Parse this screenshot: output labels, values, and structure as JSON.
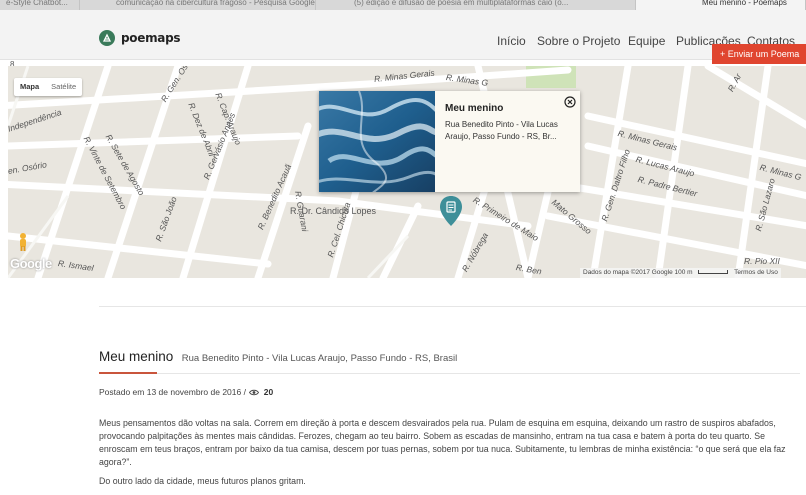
{
  "browser": {
    "tabs": [
      {
        "label": "e-Style Chatbot..."
      },
      {
        "label": "comunicação na cibercultura fragoso - Pesquisa Google"
      },
      {
        "label": "(5) edição e difusão de poesia em multiplataformas caio (o..."
      },
      {
        "label": "Meu menino - Poemaps"
      }
    ]
  },
  "header": {
    "logo_text": "poemaps",
    "nav": [
      "Início",
      "Sobre o Projeto",
      "Equipe",
      "Publicações",
      "Contatos"
    ],
    "send_button": "+ Enviar um Poema",
    "mark": "8"
  },
  "map": {
    "type_control": {
      "map": "Mapa",
      "satellite": "Satélite"
    },
    "streets": [
      "R. Minas Gerais",
      "R. Minas G",
      "R. Gen. Osório",
      "R. Cap. Araujo",
      "R. Dez de Abril",
      "Independência",
      "R. Sete de Agosto",
      "R. Vinte de Setembro",
      "R. Gervásio Annes",
      "en. Osório",
      "R. Benedito Acauã",
      "R. Guarani",
      "R. Dr. Cândido Lopes",
      "R. São João",
      "R. Ismael",
      "R. Cel. Chicuta",
      "R. Primeiro de Maio",
      "Mato Grosso",
      "R. Gen. Daltro Filho",
      "R. Minas Gerais",
      "R. Lucas Araujo",
      "R. Padre Bertier",
      "R. São Lazaro",
      "R. Minas G",
      "R. Pio XII",
      "R. Ben",
      "R. Nóbrega",
      "R. Ar"
    ],
    "google_label": "Google",
    "attribution": "Dados do mapa ©2017 Google   100 m",
    "terms": "Termos de Uso",
    "marker_icon": "map-pin-icon",
    "infowindow": {
      "title": "Meu menino",
      "address": "Rua Benedito Pinto - Vila Lucas Araujo, Passo Fundo - RS, Br..."
    }
  },
  "post": {
    "title": "Meu menino",
    "location": "Rua Benedito Pinto - Vila Lucas Araujo, Passo Fundo - RS, Brasil",
    "posted_prefix": "Postado em 13 de novembro de 2016 /",
    "views": "20",
    "paragraphs": [
      "Meus pensamentos dão voltas na sala. Correm em direção à porta e descem desvairados pela rua. Pulam de esquina em esquina, deixando um rastro de suspiros abafados, provocando palpitações às mentes mais cândidas. Ferozes, chegam ao teu bairro. Sobem as escadas de mansinho, entram na tua casa e batem à porta do teu quarto. Se enroscam em teus braços, entram por baixo da tua camisa, descem por tuas pernas, sobem por tua nuca. Subitamente, tu lembras de minha existência: “o que será que ela faz agora?”.",
      "Do outro lado da cidade, meus futuros planos gritam."
    ]
  },
  "colors": {
    "accent": "#e0452f",
    "underline": "#c9553c",
    "marker": "#3e8f99",
    "logo": "#3a7a5a"
  }
}
